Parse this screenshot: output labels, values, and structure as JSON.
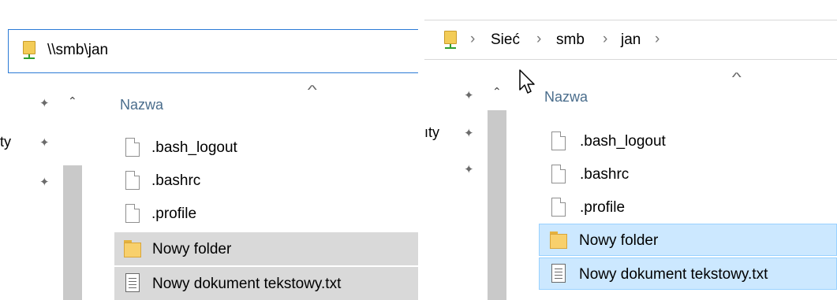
{
  "left": {
    "address": "\\\\smb\\jan",
    "nav_partial_text": "ty",
    "column_header": "Nazwa",
    "files": [
      ".bash_logout",
      ".bashrc",
      ".profile",
      "Nowy folder",
      "Nowy dokument tekstowy.txt"
    ]
  },
  "right": {
    "breadcrumbs": [
      "Sieć",
      "smb",
      "jan"
    ],
    "nav_partial_text": "ıty",
    "column_header": "Nazwa",
    "files": [
      ".bash_logout",
      ".bashrc",
      ".profile",
      "Nowy folder",
      "Nowy dokument tekstowy.txt"
    ]
  },
  "colors": {
    "selection_gray": "#d9d9d9",
    "selection_blue": "#cce8ff",
    "selection_blue_border": "#99d1ff",
    "address_focus_border": "#2b7bd6",
    "column_header_text": "#4a6d8c"
  },
  "icons": {
    "network": "network-location-icon",
    "file": "blank-file-icon",
    "folder": "folder-icon",
    "text_file": "text-file-icon",
    "pin": "pin-icon",
    "cursor": "mouse-pointer-icon"
  }
}
